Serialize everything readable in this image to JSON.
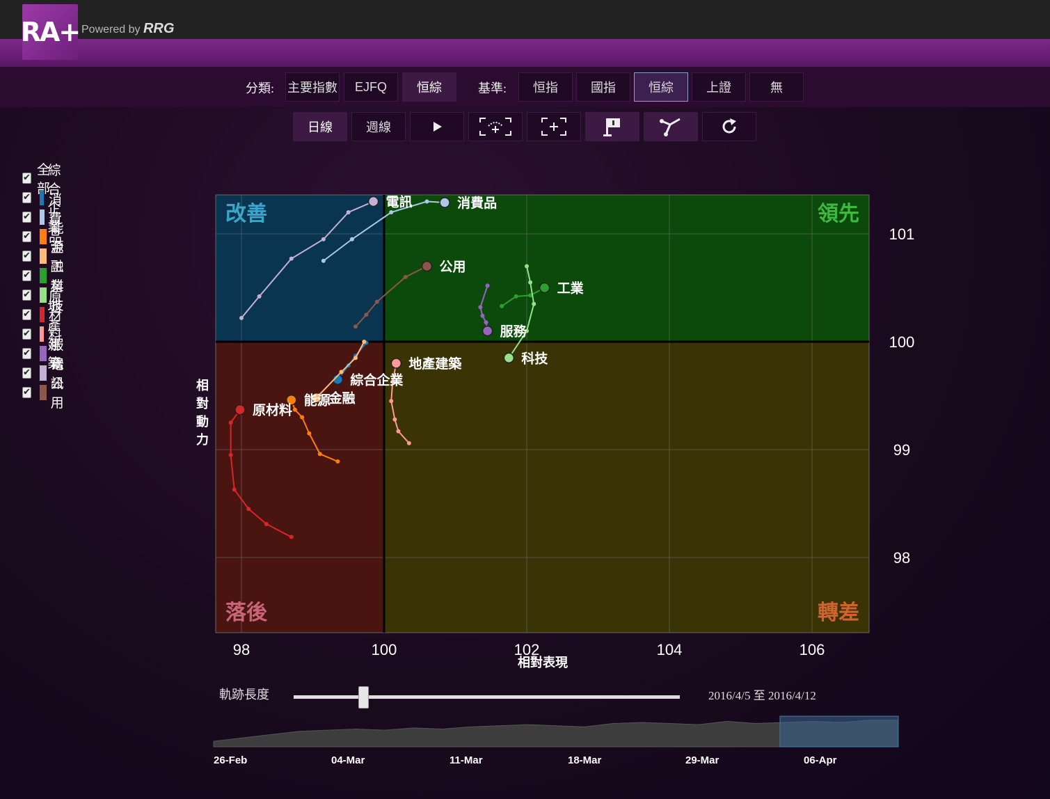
{
  "app": {
    "logo_text": "RA+",
    "powered_prefix": "Powered by ",
    "powered_brand": "RRG"
  },
  "category": {
    "label": "分類:",
    "buttons": [
      "主要指數",
      "EJFQ",
      "恒綜"
    ],
    "active_index": 2
  },
  "benchmark": {
    "label": "基準:",
    "buttons": [
      "恒指",
      "國指",
      "恒綜",
      "上證",
      "無"
    ],
    "selected_index": 2
  },
  "period": {
    "buttons": [
      "日線",
      "週線"
    ],
    "active_index": 0
  },
  "tools": [
    {
      "icon": "play-icon"
    },
    {
      "icon": "zoom-fit-icon"
    },
    {
      "icon": "zoom-box-icon"
    },
    {
      "icon": "flag-icon",
      "active": true
    },
    {
      "icon": "trail-icon",
      "active": true
    },
    {
      "icon": "refresh-icon"
    }
  ],
  "legend": [
    {
      "label": "全部",
      "color": ""
    },
    {
      "label": "綜合企業",
      "color": "#1f77b4"
    },
    {
      "label": "消費品",
      "color": "#aec7e8"
    },
    {
      "label": "能源",
      "color": "#ff7f0e"
    },
    {
      "label": "金融",
      "color": "#ffbb78"
    },
    {
      "label": "工業",
      "color": "#2ca02c"
    },
    {
      "label": "科技",
      "color": "#98df8a"
    },
    {
      "label": "原材料",
      "color": "#d62728"
    },
    {
      "label": "地產建築",
      "color": "#ff9896"
    },
    {
      "label": "服務",
      "color": "#9467bd"
    },
    {
      "label": "電訊",
      "color": "#c5b0d5"
    },
    {
      "label": "公用",
      "color": "#8c564b"
    }
  ],
  "controls": {
    "trail_label": "軌跡長度",
    "trail_value": 0.18,
    "date_range": "2016/4/5 至 2016/4/12"
  },
  "chart_data": {
    "type": "scatter",
    "xlabel": "相對表現",
    "ylabel": "相對動力",
    "xlim": [
      97.6,
      106.8
    ],
    "ylim": [
      97.3,
      101.35
    ],
    "x_ticks": [
      98,
      100,
      102,
      104,
      106
    ],
    "y_ticks": [
      98,
      99,
      100,
      101
    ],
    "center": [
      100,
      100
    ],
    "quadrants": {
      "top_left": {
        "label": "改善",
        "color": "#0a3550",
        "text_color": "#3aa6c9"
      },
      "top_right": {
        "label": "領先",
        "color": "#0b4a0b",
        "text_color": "#3fb83f"
      },
      "bottom_left": {
        "label": "落後",
        "color": "#4a1410",
        "text_color": "#c9657a"
      },
      "bottom_right": {
        "label": "轉差",
        "color": "#3a3306",
        "text_color": "#d0642e"
      }
    },
    "series": [
      {
        "name": "綜合企業",
        "color": "#1f77b4",
        "points": [
          [
            99.75,
            99.99
          ],
          [
            99.6,
            99.87
          ],
          [
            99.5,
            99.78
          ],
          [
            99.35,
            99.65
          ]
        ]
      },
      {
        "name": "消費品",
        "color": "#aec7e8",
        "points": [
          [
            99.15,
            100.75
          ],
          [
            99.55,
            100.95
          ],
          [
            100.1,
            101.2
          ],
          [
            100.6,
            101.3
          ],
          [
            100.85,
            101.29
          ]
        ]
      },
      {
        "name": "能源",
        "color": "#ff7f0e",
        "points": [
          [
            99.35,
            98.89
          ],
          [
            99.1,
            98.96
          ],
          [
            98.95,
            99.15
          ],
          [
            98.85,
            99.3
          ],
          [
            98.75,
            99.37
          ],
          [
            98.7,
            99.46
          ]
        ]
      },
      {
        "name": "金融",
        "color": "#ffbb78",
        "points": [
          [
            99.72,
            100.0
          ],
          [
            99.6,
            99.85
          ],
          [
            99.4,
            99.72
          ],
          [
            99.05,
            99.48
          ]
        ]
      },
      {
        "name": "工業",
        "color": "#2ca02c",
        "points": [
          [
            101.65,
            100.33
          ],
          [
            101.85,
            100.42
          ],
          [
            102.05,
            100.43
          ],
          [
            102.25,
            100.5
          ]
        ]
      },
      {
        "name": "科技",
        "color": "#98df8a",
        "points": [
          [
            102.0,
            100.7
          ],
          [
            102.05,
            100.55
          ],
          [
            102.1,
            100.35
          ],
          [
            102.0,
            100.1
          ],
          [
            101.75,
            99.85
          ]
        ]
      },
      {
        "name": "原材料",
        "color": "#d62728",
        "points": [
          [
            98.7,
            98.19
          ],
          [
            98.35,
            98.31
          ],
          [
            98.1,
            98.45
          ],
          [
            97.9,
            98.63
          ],
          [
            97.85,
            98.95
          ],
          [
            97.85,
            99.25
          ],
          [
            97.98,
            99.37
          ]
        ]
      },
      {
        "name": "地產建築",
        "color": "#ff9896",
        "points": [
          [
            100.35,
            99.06
          ],
          [
            100.2,
            99.17
          ],
          [
            100.15,
            99.28
          ],
          [
            100.1,
            99.45
          ],
          [
            100.12,
            99.63
          ],
          [
            100.17,
            99.8
          ]
        ]
      },
      {
        "name": "服務",
        "color": "#9467bd",
        "points": [
          [
            101.45,
            100.52
          ],
          [
            101.35,
            100.32
          ],
          [
            101.38,
            100.24
          ],
          [
            101.43,
            100.18
          ],
          [
            101.45,
            100.1
          ]
        ]
      },
      {
        "name": "電訊",
        "color": "#c5b0d5",
        "points": [
          [
            98.0,
            100.22
          ],
          [
            98.25,
            100.42
          ],
          [
            98.7,
            100.77
          ],
          [
            99.15,
            100.95
          ],
          [
            99.5,
            101.2
          ],
          [
            99.85,
            101.3
          ]
        ]
      },
      {
        "name": "公用",
        "color": "#8c564b",
        "points": [
          [
            99.6,
            100.14
          ],
          [
            99.75,
            100.25
          ],
          [
            99.9,
            100.37
          ],
          [
            100.3,
            100.6
          ],
          [
            100.6,
            100.7
          ]
        ]
      }
    ],
    "point_labels": [
      {
        "series": "電訊",
        "text": "電訊"
      },
      {
        "series": "消費品",
        "text": "消費品"
      },
      {
        "series": "公用",
        "text": "公用"
      },
      {
        "series": "工業",
        "text": "工業"
      },
      {
        "series": "服務",
        "text": "服務"
      },
      {
        "series": "科技",
        "text": "科技"
      },
      {
        "series": "地產建築",
        "text": "地產建築"
      },
      {
        "series": "綜合企業",
        "text": "綜合企業"
      },
      {
        "series": "金融",
        "text": "金融"
      },
      {
        "series": "能源",
        "text": "能源"
      },
      {
        "series": "原材料",
        "text": "原材料"
      }
    ]
  },
  "navigator": {
    "dates": [
      "26-Feb",
      "04-Mar",
      "11-Mar",
      "18-Mar",
      "29-Mar",
      "06-Apr"
    ],
    "values": [
      100.0,
      100.3,
      100.6,
      100.9,
      101.0,
      101.1,
      101.0,
      101.2,
      101.1,
      101.3,
      101.4,
      101.5,
      101.4,
      101.3,
      101.6,
      101.7,
      101.6,
      101.5,
      101.8,
      101.6,
      101.7,
      101.8,
      101.7,
      101.9,
      101.9
    ]
  }
}
